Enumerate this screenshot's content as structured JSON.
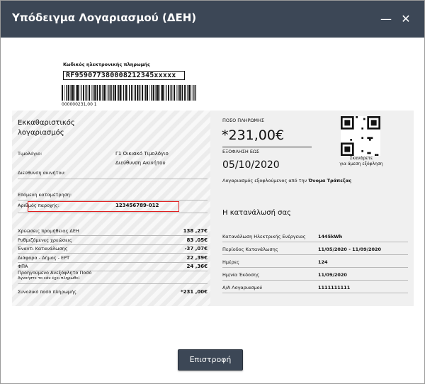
{
  "window": {
    "title": "Υπόδειγμα Λογαριασμού (ΔΕΗ)",
    "minimize_glyph": "—",
    "close_glyph": "✕"
  },
  "bill": {
    "payment_code_label": "Κωδικός ηλεκτρονικής πληρωμής",
    "payment_code": "RF959077380008212345xxxxx",
    "barcode_number": "000000231,00 1",
    "settlement_title_1": "Εκκαθαριστικός",
    "settlement_title_2": "λογαριασμός",
    "invoice_label": "Τιμολόγιο:",
    "invoice_value": "Γ1 Οικιακό Τιμολόγιο",
    "address_value": "Διεύθυνση Ακινήτου",
    "address_label": "Διεύθυνση ακινήτου:",
    "next_meter_label": "Επόμενη καταμέτρηση:",
    "supply_number_label": "Αριθμός παροχής:",
    "supply_number": "123456789-012",
    "charges": [
      {
        "label": "Χρεώσεις προμήθειας ΔΕΗ",
        "value": "138 ,27€"
      },
      {
        "label": "Ρυθμιζόμενες χρεώσεις",
        "value": "83 ,05€"
      },
      {
        "label": "Έναντι Κατανάλωσης",
        "value": "-37 ,07€"
      },
      {
        "label": "Διάφορα - Δήμος - ΕΡΤ",
        "value": "22 ,39€"
      },
      {
        "label": "ΦΠΑ",
        "value": "24 ,36€"
      }
    ],
    "previous_unpaid_label": "Προηγούμενο Ανεξόφλητο Ποσό",
    "previous_unpaid_note": "Αγνοήστε το εάν έχει πληρωθεί",
    "total_label": "Συνολικό ποσό πληρωμής",
    "total_value": "*231 ,00€",
    "pay_amount_label": "ΠΟΣΟ ΠΛΗΡΩΜΗΣ",
    "pay_amount": "*231,00€",
    "due_label": "ΕΞΟΦΛΗΣΗ ΕΩΣ",
    "due_date": "05/10/2020",
    "paid_via_text": "Λογαριασμός εξοφλούμενος από την",
    "bank_name": "Όνομα Τράπεζας",
    "qr_caption_1": "Σκανάρετε",
    "qr_caption_2": "για άμεση εξόφληση",
    "consumption_title": "Η κατανάλωσή σας",
    "consumption_rows": [
      {
        "label": "Κατανάλωση Ηλεκτρικής Ενέργειας",
        "value": "1445kWh"
      },
      {
        "label": "Περίοδος Κατανάλωσης",
        "value": "11/05/2020  -  11/09/2020"
      },
      {
        "label": "Ημέρες",
        "value": "124"
      },
      {
        "label": "Ημ/νία Έκδοσης",
        "value": "11/09/2020"
      },
      {
        "label": "Α/Α Λογαριασμού",
        "value": "1111111111"
      }
    ]
  },
  "footer": {
    "back_label": "Επιστροφή"
  }
}
